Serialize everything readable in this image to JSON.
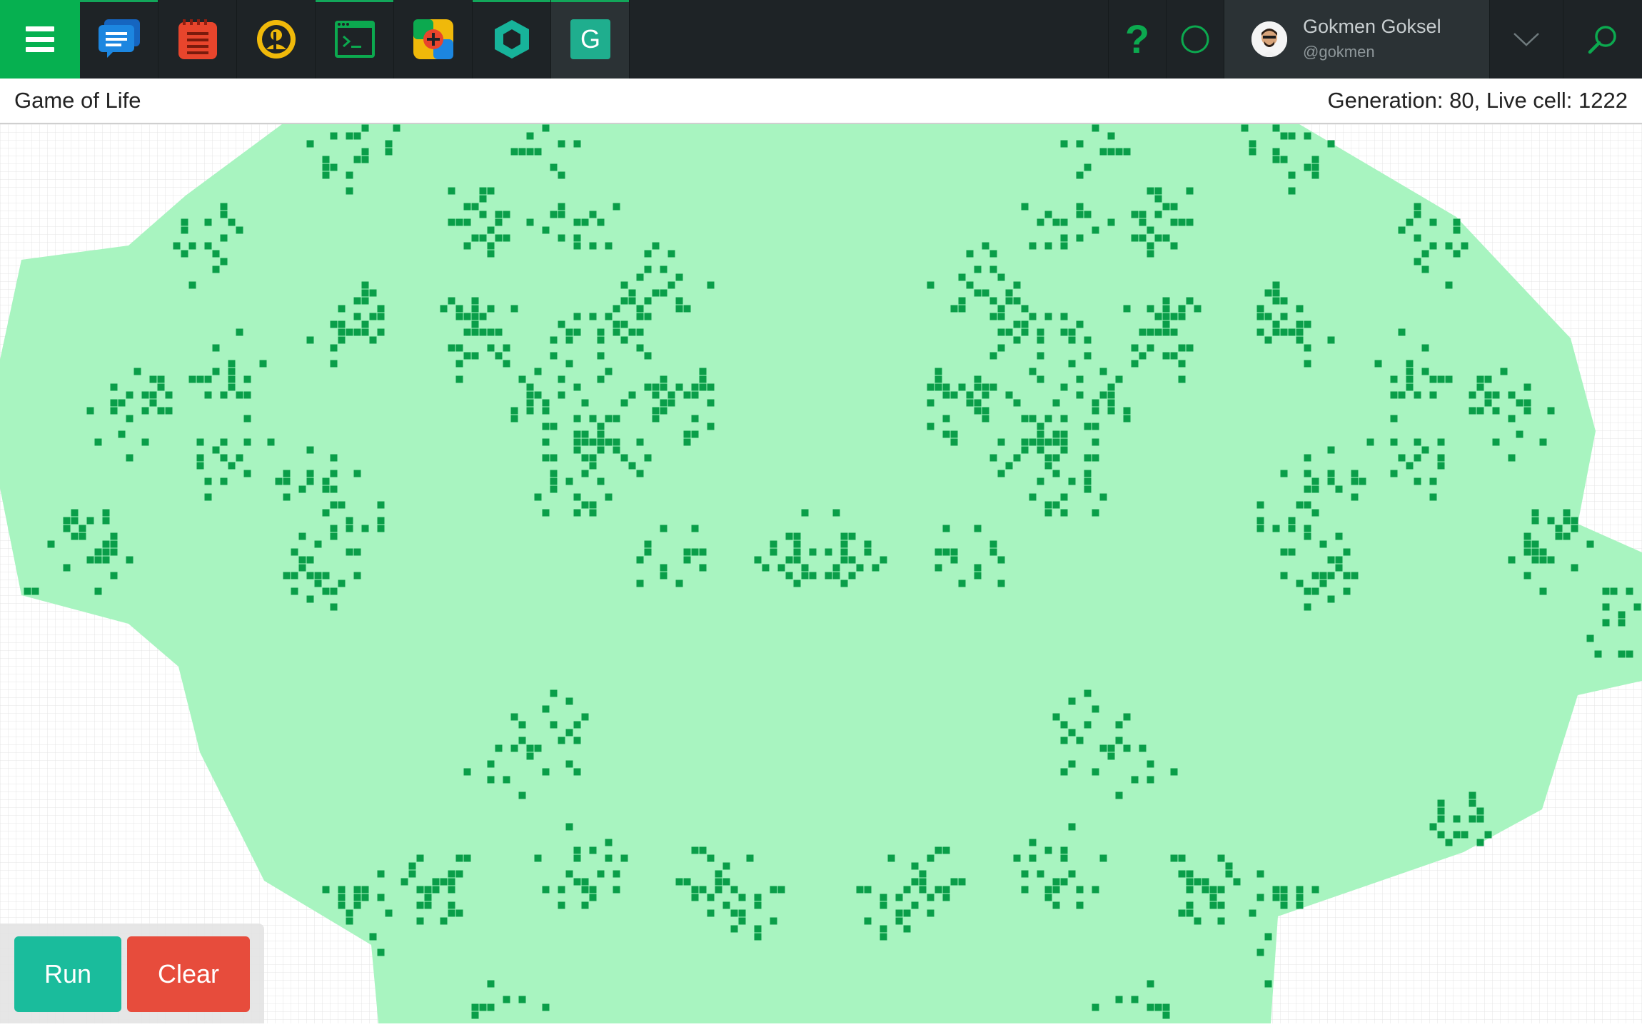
{
  "topbar": {
    "menu_icon": "hamburger-menu-icon",
    "apps": [
      {
        "name": "chat",
        "icon": "chat-bubbles-icon",
        "color": "#1c86e0",
        "active": true
      },
      {
        "name": "notes",
        "icon": "notepad-icon",
        "color": "#e8452c",
        "active": false
      },
      {
        "name": "contacts",
        "icon": "contact-card-icon",
        "color": "#f0b90a",
        "active": false
      },
      {
        "name": "terminal",
        "icon": "terminal-icon",
        "color": "#0ca94f",
        "active": true
      },
      {
        "name": "health",
        "icon": "medical-cross-icon",
        "color": "#f0b90a",
        "active": false
      },
      {
        "name": "hexagon",
        "icon": "hexagon-icon",
        "color": "#17b39a",
        "active": true
      },
      {
        "name": "game-of-life",
        "icon": "g-letter-icon",
        "label": "G",
        "color": "#1fae8e",
        "active": true
      }
    ],
    "help_label": "?",
    "user": {
      "name": "Gokmen Goksel",
      "handle": "@gokmen"
    }
  },
  "page": {
    "title": "Game of Life",
    "status": "Generation: 80, Live cell: 1222"
  },
  "grid": {
    "live_color": "#0a9e49",
    "visited_color": "#a8f4c0",
    "line_color": "#e4e4e4"
  },
  "controls": {
    "run_label": "Run",
    "clear_label": "Clear"
  }
}
